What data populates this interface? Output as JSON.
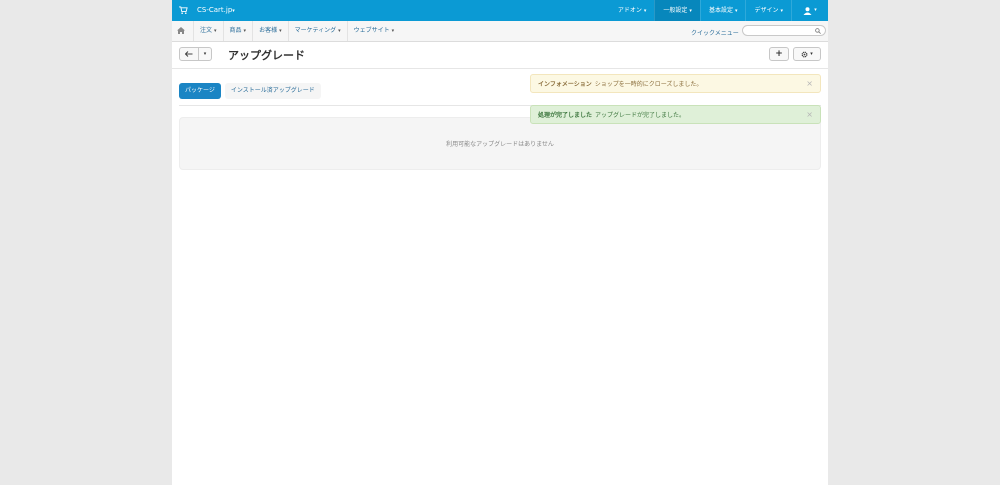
{
  "topbar": {
    "brand": "CS-Cart.jp",
    "menu": [
      {
        "label": "アドオン"
      },
      {
        "label": "一般設定"
      },
      {
        "label": "基本設定"
      },
      {
        "label": "デザイン"
      }
    ],
    "bg_color": "#0b9ad4"
  },
  "subnav": {
    "items": [
      {
        "label": "注文"
      },
      {
        "label": "商品"
      },
      {
        "label": "お客様"
      },
      {
        "label": "マーケティング"
      },
      {
        "label": "ウェブサイト"
      }
    ],
    "quick_menu": "クイックメニュー",
    "search_placeholder": ""
  },
  "toolbar": {
    "title": "アップグレード",
    "add_label": "+"
  },
  "tabs": [
    {
      "label": "パッケージ",
      "active": true
    },
    {
      "label": "インストール済アップグレード",
      "active": false
    }
  ],
  "content": {
    "empty_message": "利用可能なアップグレードはありません"
  },
  "notifications": [
    {
      "type": "info",
      "title": "インフォメーション",
      "message": "ショップを一時的にクローズしました。",
      "color": "#fcf8e3"
    },
    {
      "type": "success",
      "title": "処理が完了しました",
      "message": "アップグレードが完了しました。",
      "color": "#dff0d8"
    }
  ]
}
